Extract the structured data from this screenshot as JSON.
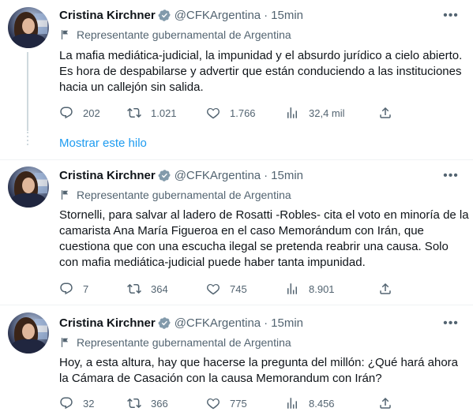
{
  "tweets": [
    {
      "name": "Cristina Kirchner",
      "handle": "@CFKArgentina",
      "time": "15min",
      "label": "Representante gubernamental de Argentina",
      "text": "La mafia mediática-judicial, la impunidad y el absurdo jurídico a cielo abierto. Es hora de despabilarse y advertir que están conduciendo a las instituciones hacia un callejón sin salida.",
      "replies": "202",
      "retweets": "1.021",
      "likes": "1.766",
      "views": "32,4 mil"
    },
    {
      "name": "Cristina Kirchner",
      "handle": "@CFKArgentina",
      "time": "15min",
      "label": "Representante gubernamental de Argentina",
      "text": "Stornelli, para salvar al ladero de Rosatti -Robles- cita el voto en minoría de la camarista Ana María Figueroa en el caso Memorándum con Irán, que cuestiona que con una escucha ilegal se pretenda reabrir una causa. Solo con mafia mediática-judicial puede haber tanta impunidad.",
      "replies": "7",
      "retweets": "364",
      "likes": "745",
      "views": "8.901"
    },
    {
      "name": "Cristina Kirchner",
      "handle": "@CFKArgentina",
      "time": "15min",
      "label": "Representante gubernamental de Argentina",
      "text": "Hoy, a esta altura, hay que hacerse la pregunta del millón: ¿Qué hará ahora la Cámara de Casación con la causa Memorandum con Irán?",
      "replies": "32",
      "retweets": "366",
      "likes": "775",
      "views": "8.456"
    }
  ],
  "show_thread": "Mostrar este hilo",
  "colors": {
    "accent": "#1d9bf0",
    "muted": "#536471",
    "text": "#0f1419",
    "line": "#cfd9de"
  },
  "icons": {
    "verified": "verified-badge-icon",
    "label": "flag-icon",
    "reply": "reply-icon",
    "retweet": "retweet-icon",
    "like": "heart-icon",
    "views": "views-icon",
    "share": "share-icon",
    "more": "more-dots-icon"
  }
}
